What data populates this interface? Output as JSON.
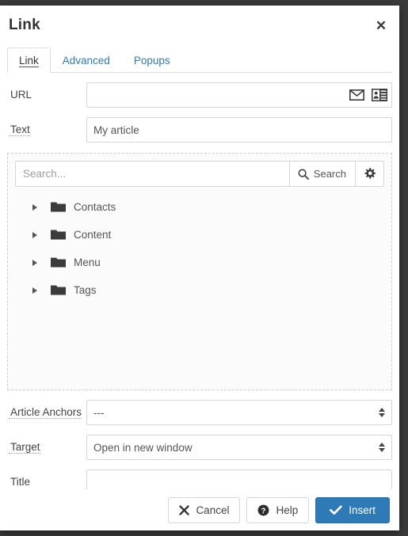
{
  "dialog": {
    "title": "Link",
    "close_icon": "close-icon"
  },
  "tabs": [
    {
      "label": "Link",
      "active": true
    },
    {
      "label": "Advanced",
      "active": false
    },
    {
      "label": "Popups",
      "active": false
    }
  ],
  "fields": {
    "url": {
      "label": "URL",
      "value": "",
      "placeholder": "",
      "icons": [
        "mail-icon",
        "contact-card-icon"
      ]
    },
    "text": {
      "label": "Text",
      "value": "My article",
      "placeholder": ""
    },
    "article_anchors": {
      "label": "Article Anchors",
      "value": "---",
      "options": [
        "---"
      ]
    },
    "target": {
      "label": "Target",
      "value": "Open in new window",
      "options": [
        "Open in new window"
      ]
    },
    "title": {
      "label": "Title",
      "value": "",
      "placeholder": ""
    }
  },
  "browser_panel": {
    "search": {
      "placeholder": "Search...",
      "value": "",
      "button_label": "Search",
      "button_icon": "magnifier-icon",
      "settings_icon": "gear-icon"
    },
    "tree": [
      {
        "label": "Contacts",
        "icon": "folder-icon",
        "expanded": false
      },
      {
        "label": "Content",
        "icon": "folder-icon",
        "expanded": false
      },
      {
        "label": "Menu",
        "icon": "folder-icon",
        "expanded": false
      },
      {
        "label": "Tags",
        "icon": "folder-icon",
        "expanded": false
      }
    ]
  },
  "footer": {
    "cancel": {
      "label": "Cancel",
      "icon": "x-icon"
    },
    "help": {
      "label": "Help",
      "icon": "question-circle-icon"
    },
    "insert": {
      "label": "Insert",
      "icon": "check-icon"
    }
  },
  "colors": {
    "primary": "#2e7ab6",
    "link": "#337ab7",
    "text": "#555555",
    "border": "#d6d6d6"
  }
}
